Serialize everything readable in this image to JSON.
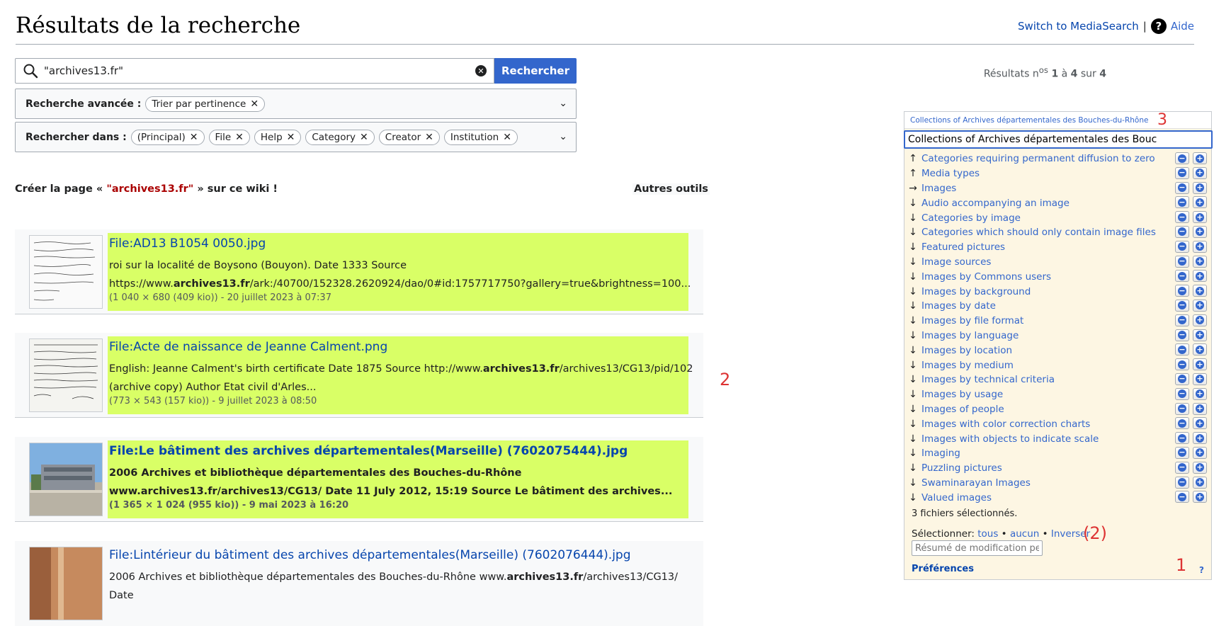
{
  "page": {
    "title": "Résultats de la recherche",
    "switch_link": "Switch to MediaSearch",
    "separator": "|",
    "help_icon": "?",
    "help_label": "Aide"
  },
  "search": {
    "query": "\"archives13.fr\"",
    "button": "Rechercher",
    "results_prefix": "Résultats n",
    "results_sup": "os",
    "results_from": "1",
    "results_mid": " à ",
    "results_to": "4",
    "results_sur": " sur ",
    "results_total": "4"
  },
  "advanced": {
    "label": "Recherche avancée :",
    "chips": [
      "Trier par pertinence"
    ]
  },
  "namespaces": {
    "label": "Rechercher dans :",
    "chips": [
      "(Principal)",
      "File",
      "Help",
      "Category",
      "Creator",
      "Institution"
    ]
  },
  "create": {
    "prefix": "Créer la page « ",
    "term": "\"archives13.fr\"",
    "suffix": " » sur ce wiki !"
  },
  "other_tools": "Autres outils",
  "results": [
    {
      "title": "File:AD13 B1054 0050.jpg",
      "snippet_pre": "roi sur la localité de Boysono (Bouyon). Date 1333 Source https://www.",
      "snippet_bold": "archives13.fr",
      "snippet_post": "/ark:/40700/152328.2620924/dao/0#id:1757717750?gallery=true&brightness=100...",
      "meta": "(1 040 × 680 (409 kio)) - 20 juillet 2023 à 07:37"
    },
    {
      "title": "File:Acte de naissance de Jeanne Calment.png",
      "snippet_pre": "English: Jeanne Calment's birth certificate Date 1875 Source http://www.",
      "snippet_bold": "archives13.fr",
      "snippet_post": "/archives13/CG13/pid/102 (archive copy) Author Etat civil d'Arles...",
      "meta": "(773 × 543 (157 kio)) - 9 juillet 2023 à 08:50"
    },
    {
      "title": "File:Le bâtiment des archives départementales(Marseille) (7602075444).jpg",
      "snippet_pre": "2006 Archives et bibliothèque départementales des Bouches-du-Rhône www.archives13.fr/archives13/CG13/ Date 11 July 2012, 15:19 Source Le bâtiment des archives...",
      "snippet_bold": "",
      "snippet_post": "",
      "meta": "(1 365 × 1 024 (955 kio)) - 9 mai 2023 à 16:20"
    },
    {
      "title": "File:Lintérieur du bâtiment des archives départementales(Marseille) (7602076444).jpg",
      "snippet_pre": "2006 Archives et bibliothèque départementales des Bouches-du-Rhône www.",
      "snippet_bold": "archives13.fr",
      "snippet_post": "/archives13/CG13/ Date",
      "meta": ""
    }
  ],
  "annotations": {
    "a1": "1",
    "a2": "2",
    "a2b": "(2)",
    "a3": "3"
  },
  "panel": {
    "header": "Collections of Archives départementales des Bouches-du-Rhône",
    "input_value": "Collections of Archives départementales des Bouc",
    "categories": [
      {
        "arrow": "↑",
        "label": "Categories requiring permanent diffusion to zero"
      },
      {
        "arrow": "↑",
        "label": "Media types"
      },
      {
        "arrow": "→",
        "label": "Images"
      },
      {
        "arrow": "↓",
        "label": "Audio accompanying an image"
      },
      {
        "arrow": "↓",
        "label": "Categories by image"
      },
      {
        "arrow": "↓",
        "label": "Categories which should only contain image files"
      },
      {
        "arrow": "↓",
        "label": "Featured pictures"
      },
      {
        "arrow": "↓",
        "label": "Image sources"
      },
      {
        "arrow": "↓",
        "label": "Images by Commons users"
      },
      {
        "arrow": "↓",
        "label": "Images by background"
      },
      {
        "arrow": "↓",
        "label": "Images by date"
      },
      {
        "arrow": "↓",
        "label": "Images by file format"
      },
      {
        "arrow": "↓",
        "label": "Images by language"
      },
      {
        "arrow": "↓",
        "label": "Images by location"
      },
      {
        "arrow": "↓",
        "label": "Images by medium"
      },
      {
        "arrow": "↓",
        "label": "Images by technical criteria"
      },
      {
        "arrow": "↓",
        "label": "Images by usage"
      },
      {
        "arrow": "↓",
        "label": "Images of people"
      },
      {
        "arrow": "↓",
        "label": "Images with color correction charts"
      },
      {
        "arrow": "↓",
        "label": "Images with objects to indicate scale"
      },
      {
        "arrow": "↓",
        "label": "Imaging"
      },
      {
        "arrow": "↓",
        "label": "Puzzling pictures"
      },
      {
        "arrow": "↓",
        "label": "Swaminarayan Images"
      },
      {
        "arrow": "↓",
        "label": "Valued images"
      }
    ],
    "selected_count": "3 fichiers sélectionnés.",
    "select_label": "Sélectionner: ",
    "select_all": "tous",
    "select_none": "aucun",
    "select_invert": "Inverser",
    "bullet": " • ",
    "summary_placeholder": "Résumé de modification pe",
    "preferences": "Préférences",
    "help_q": "?"
  },
  "colors": {
    "accent": "#3366cc",
    "highlight": "#d9ff66",
    "panel_bg": "#fdf6e3",
    "annotation": "#d33"
  }
}
